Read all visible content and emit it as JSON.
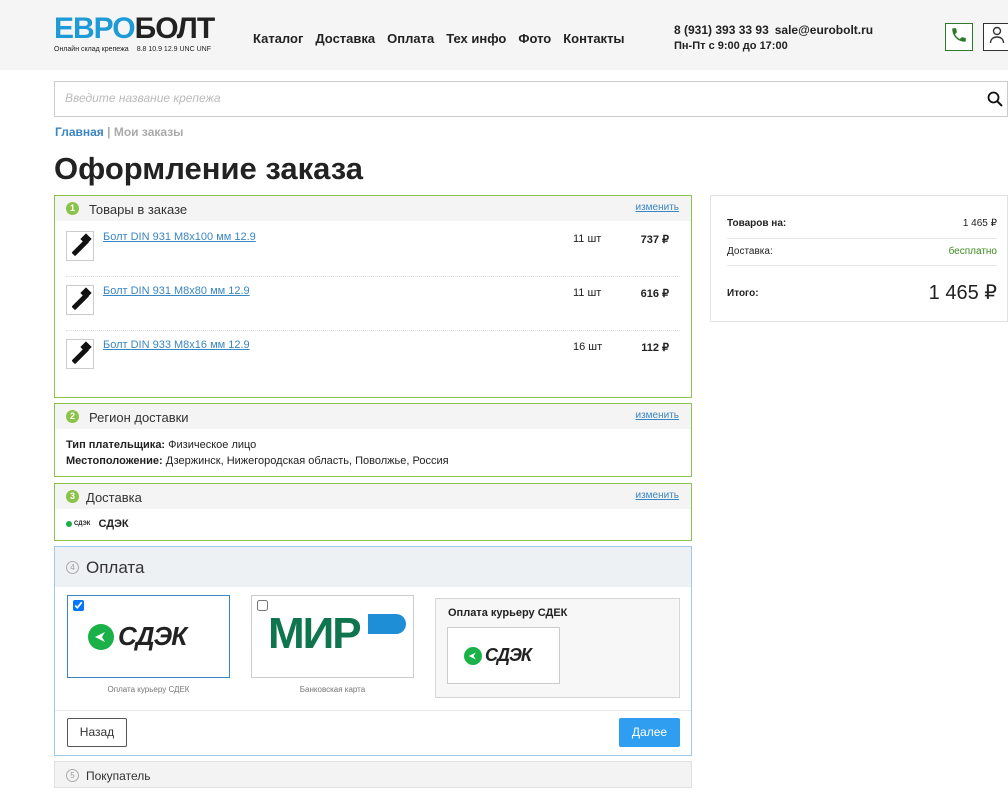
{
  "header": {
    "logo": {
      "part1": "евро",
      "part2": "болт",
      "tagline": "Онлайн склад крепежа",
      "grades": "8.8 10.9 12.9 UNC UNF"
    },
    "nav": [
      "Каталог",
      "Доставка",
      "Оплата",
      "Тех инфо",
      "Фото",
      "Контакты"
    ],
    "phone": "8 (931) 393 33 93",
    "email": "sale@eurobolt.ru",
    "hours": "Пн-Пт с 9:00 до 17:00",
    "icons": {
      "phone": "phone-icon",
      "user": "user-icon"
    }
  },
  "search": {
    "placeholder": "Введите название крепежа",
    "icon": "search-icon"
  },
  "breadcrumb": {
    "home": "Главная",
    "separator": "|",
    "current": "Мои заказы"
  },
  "page_title": "Оформление заказа",
  "steps": {
    "goods": {
      "num": "1",
      "title": "Товары в заказе",
      "edit": "изменить",
      "items": [
        {
          "name": "Болт DIN 931 M8x100 мм 12.9",
          "qty": "11 шт",
          "price": "737 ₽"
        },
        {
          "name": "Болт DIN 931 M8x80 мм 12.9",
          "qty": "11 шт",
          "price": "616 ₽"
        },
        {
          "name": "Болт DIN 933 M8x16 мм 12.9",
          "qty": "16 шт",
          "price": "112 ₽"
        }
      ]
    },
    "region": {
      "num": "2",
      "title": "Регион доставки",
      "edit": "изменить",
      "payer_label": "Тип плательщика:",
      "payer_value": "Физическое лицо",
      "location_label": "Местоположение:",
      "location_value": "Дзержинск, Нижегородская область, Поволжье, Россия"
    },
    "delivery": {
      "num": "3",
      "title": "Доставка",
      "edit": "изменить",
      "method": "СДЭК",
      "logo_text": "СДЭК"
    },
    "payment": {
      "num": "4",
      "title": "Оплата",
      "options": [
        {
          "logo": "СДЭК",
          "caption": "Оплата курьеру СДЕК",
          "checked": true
        },
        {
          "logo": "МИР",
          "caption": "Банковская карта",
          "checked": false
        }
      ],
      "selected_title": "Оплата курьеру СДЕК",
      "selected_logo": "СДЭК",
      "back": "Назад",
      "next": "Далее"
    },
    "buyer": {
      "num": "5",
      "title": "Покупатель"
    }
  },
  "summary": {
    "goods_label": "Товаров на:",
    "goods_value": "1 465 ₽",
    "delivery_label": "Доставка:",
    "delivery_value": "бесплатно",
    "total_label": "Итого:",
    "total_value": "1 465 ₽"
  },
  "colors": {
    "accent": "#2f9ef0",
    "link": "#3a86c3",
    "success": "#8bc34a",
    "cdek_green": "#1ab248",
    "mir_green": "#0f754e"
  }
}
